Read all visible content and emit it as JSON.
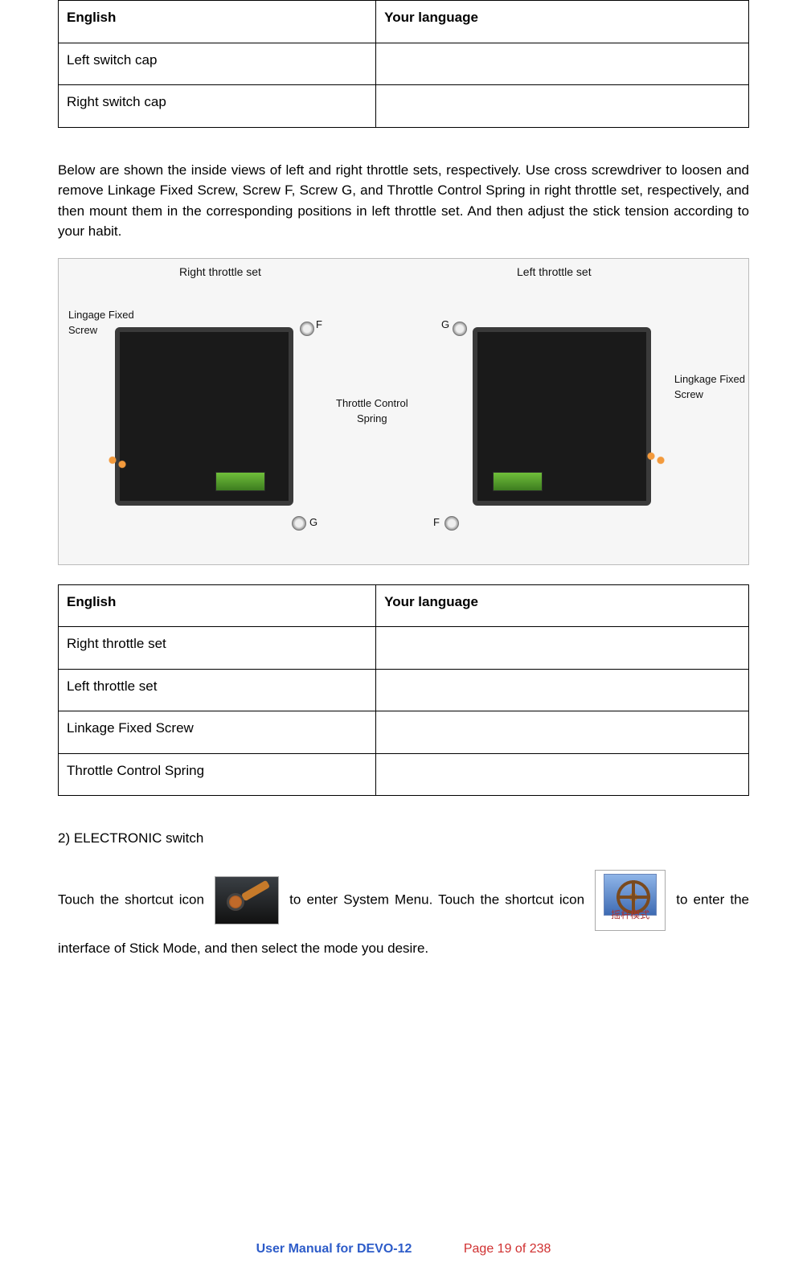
{
  "table1": {
    "head_left": "English",
    "head_right": "Your language",
    "rows": [
      "Left switch cap",
      "Right switch cap"
    ]
  },
  "paragraph1": "Below are shown the inside views of left and right throttle sets, respectively. Use cross screwdriver to loosen and remove Linkage Fixed Screw, Screw F, Screw G, and Throttle Control Spring in right throttle set, respectively, and then mount them in the corresponding positions in left throttle set. And then adjust the stick tension according to your habit.",
  "figure": {
    "right_label": "Right throttle set",
    "left_label": "Left throttle set",
    "linkage_label_left": "Lingage Fixed\nScrew",
    "linkage_label_right": "Lingkage Fixed\nScrew",
    "spring_label": "Throttle Control\nSpring",
    "F": "F",
    "G": "G"
  },
  "table2": {
    "head_left": "English",
    "head_right": "Your language",
    "rows": [
      "Right throttle set",
      "Left throttle set",
      "Linkage Fixed Screw",
      "Throttle Control Spring"
    ]
  },
  "section2_head": "2) ELECTRONIC switch",
  "p2a": "Touch the shortcut icon",
  "p2b": "to enter System Menu. Touch the shortcut icon",
  "p2c": "to enter the interface of Stick Mode, and then select the mode you desire.",
  "stickmode_cn": "摇杆模式",
  "footer": {
    "title": "User Manual for DEVO-12",
    "page": "Page 19 of 238"
  }
}
